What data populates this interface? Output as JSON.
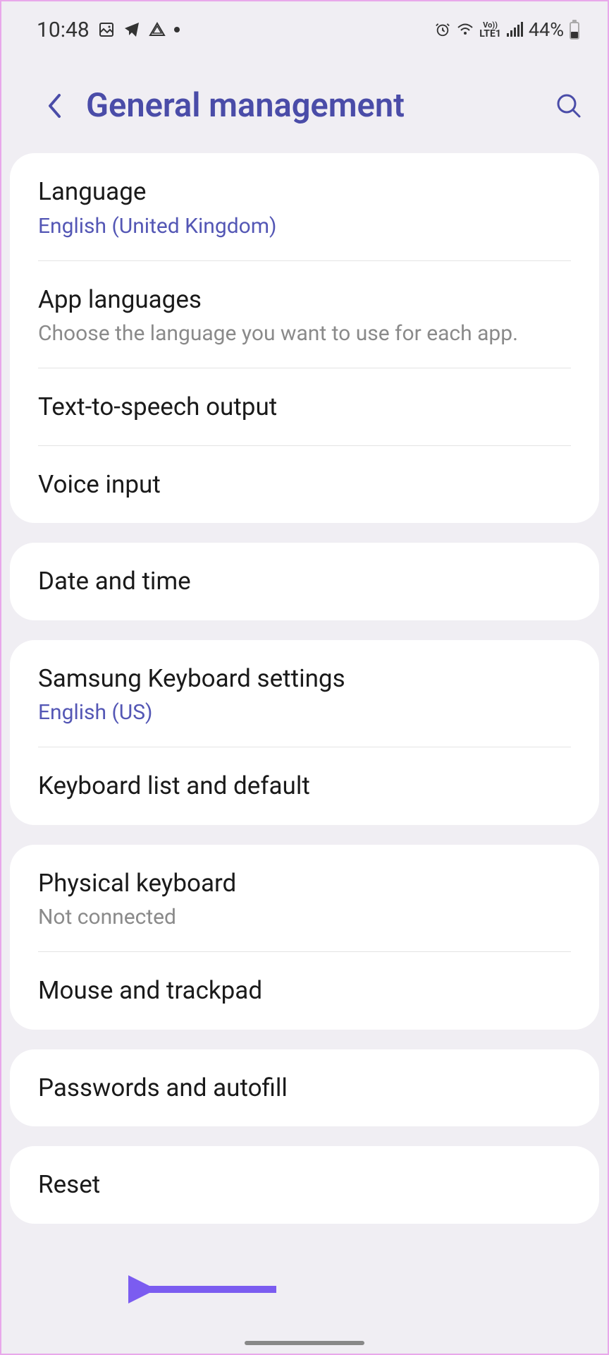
{
  "status": {
    "time": "10:48",
    "battery": "44%",
    "network": "LTE1",
    "volte": "Vo))"
  },
  "header": {
    "title": "General management"
  },
  "groups": [
    {
      "items": [
        {
          "title": "Language",
          "subtitle": "English (United Kingdom)",
          "subtitleColor": "accent"
        },
        {
          "title": "App languages",
          "subtitle": "Choose the language you want to use for each app.",
          "subtitleColor": "gray"
        },
        {
          "title": "Text-to-speech output"
        },
        {
          "title": "Voice input"
        }
      ]
    },
    {
      "items": [
        {
          "title": "Date and time"
        }
      ]
    },
    {
      "items": [
        {
          "title": "Samsung Keyboard settings",
          "subtitle": "English (US)",
          "subtitleColor": "accent"
        },
        {
          "title": "Keyboard list and default"
        }
      ]
    },
    {
      "items": [
        {
          "title": "Physical keyboard",
          "subtitle": "Not connected",
          "subtitleColor": "gray"
        },
        {
          "title": "Mouse and trackpad"
        }
      ]
    },
    {
      "items": [
        {
          "title": "Passwords and autofill"
        }
      ]
    },
    {
      "items": [
        {
          "title": "Reset"
        }
      ]
    }
  ]
}
